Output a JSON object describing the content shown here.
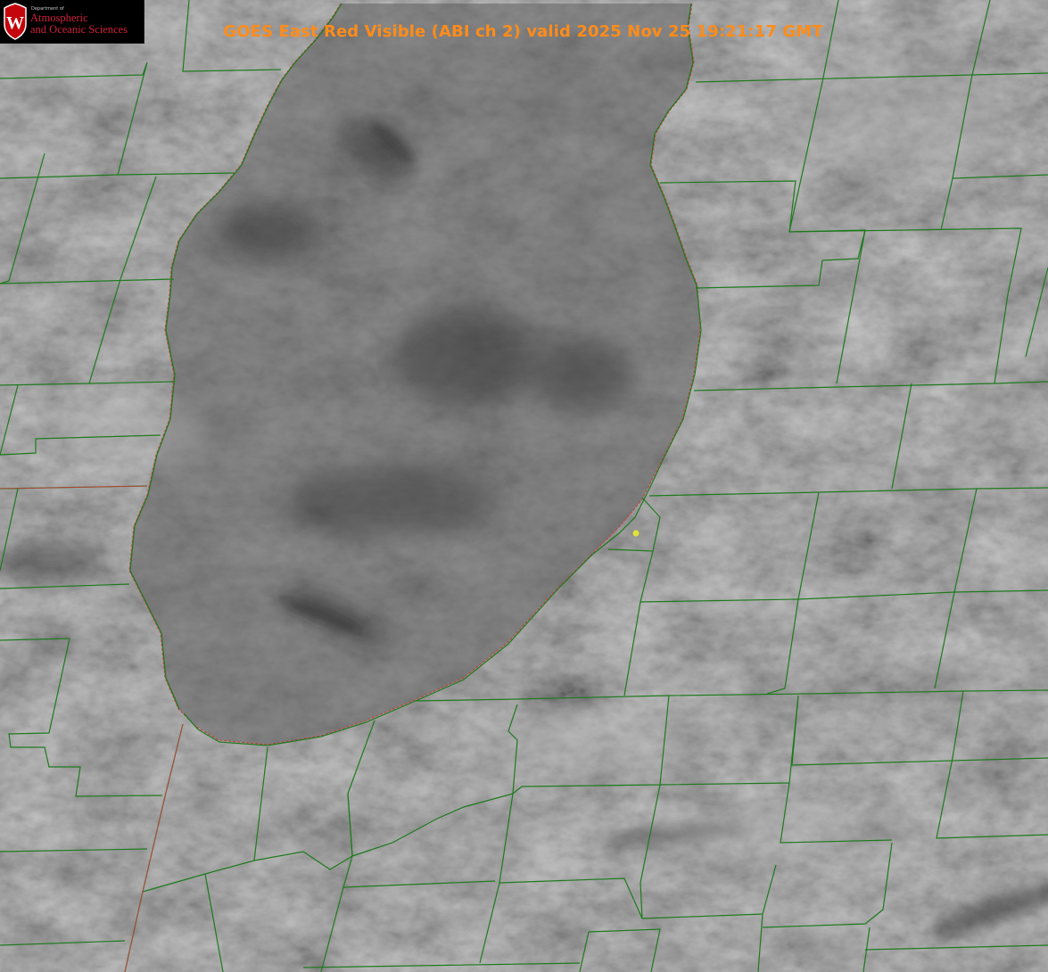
{
  "map": {
    "title": "GOES East Red Visible (ABI ch 2) valid 2025 Nov 25 19:21:17 GMT",
    "title_color": "#ff8c1a",
    "county_line_color": "#1e7a1e",
    "lake_outline_color": "#cf3a3a",
    "marker_color": "#e2e23a",
    "base_gray": "#707070",
    "lake_gray": "#5f5f5f"
  },
  "logo": {
    "department_text": "Department of",
    "line1": "Atmospheric",
    "line2": "and Oceanic Sciences",
    "crest_letter": "W",
    "crest_color": "#c5050c"
  }
}
